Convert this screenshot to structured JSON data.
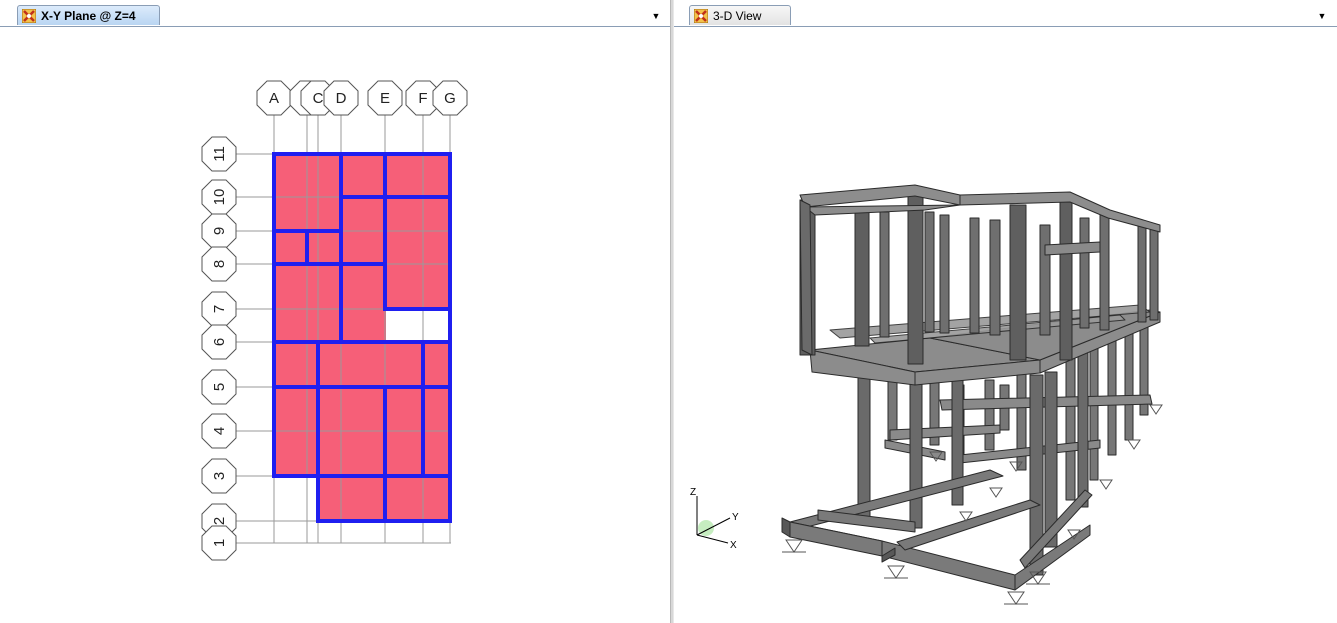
{
  "left_panel": {
    "tab_title": "X-Y Plane @ Z=4",
    "dropdown_icon": "chevron-down-icon",
    "grid_columns": [
      "A",
      "B",
      "C",
      "D",
      "E",
      "F",
      "G"
    ],
    "grid_rows": [
      "11",
      "10",
      "9",
      "8",
      "7",
      "6",
      "5",
      "4",
      "3",
      "2",
      "1"
    ]
  },
  "right_panel": {
    "tab_title": "3-D View",
    "dropdown_icon": "chevron-down-icon",
    "axes": {
      "z": "Z",
      "y": "Y",
      "x": "X"
    }
  },
  "colors": {
    "slab_fill": "#f65f78",
    "beam_blue": "#1f1ff0",
    "grid_line": "#9a9a9a",
    "frame_fill": "#6e6e6e",
    "tab_active": "#c8dcf5"
  }
}
